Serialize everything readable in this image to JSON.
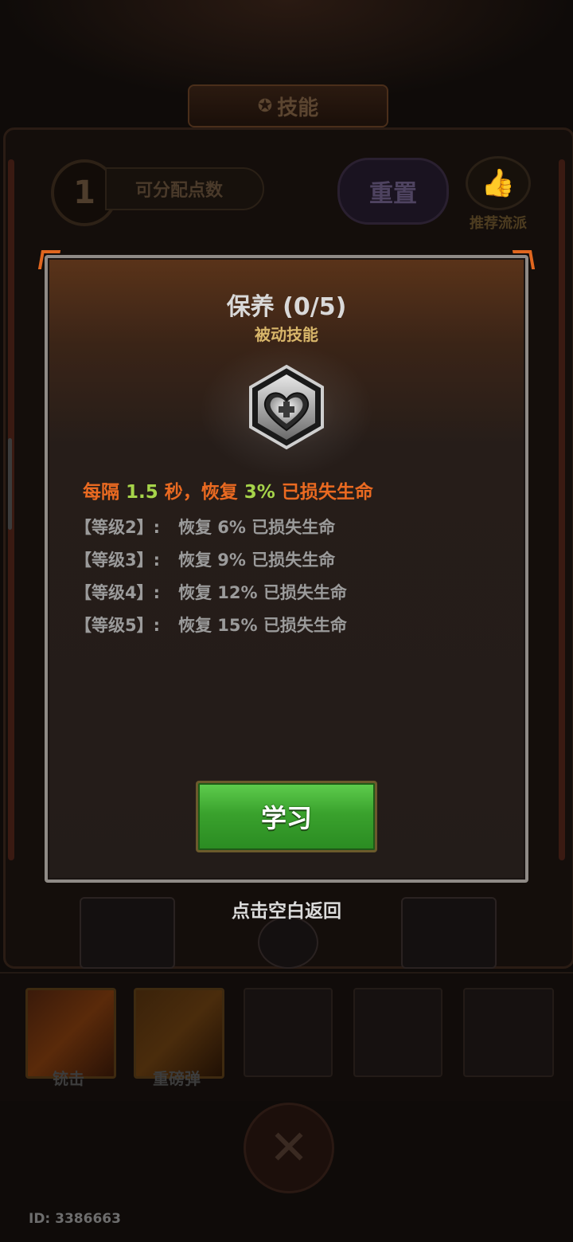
{
  "header": {
    "title": "技能"
  },
  "top_panel": {
    "skill_points": "1",
    "skill_points_label": "可分配点数",
    "reset_label": "重置",
    "recommend_label": "推荐流派"
  },
  "modal": {
    "skill_name": "保养 (0/5)",
    "skill_type": "被动技能",
    "description": {
      "prefix": "每隔 ",
      "interval": "1.5",
      "middle": " 秒，恢复 ",
      "percent": "3%",
      "suffix": " 已损失生命"
    },
    "levels": [
      {
        "level": "【等级2】:",
        "effect": "恢复 6% 已损失生命"
      },
      {
        "level": "【等级3】:",
        "effect": "恢复 9% 已损失生命"
      },
      {
        "level": "【等级4】:",
        "effect": "恢复 12% 已损失生命"
      },
      {
        "level": "【等级5】:",
        "effect": "恢复 15% 已损失生命"
      }
    ],
    "learn_label": "学习"
  },
  "tap_hint": "点击空白返回",
  "equipped_slots": [
    {
      "label": "铳击"
    },
    {
      "label": "重磅弹"
    }
  ],
  "footer": {
    "id_text": "ID: 3386663"
  },
  "colors": {
    "accent_orange": "#ea6a21",
    "accent_green": "#a6d44a",
    "skill_type_gold": "#d8b66a",
    "learn_button_green": "#3aa22d"
  }
}
